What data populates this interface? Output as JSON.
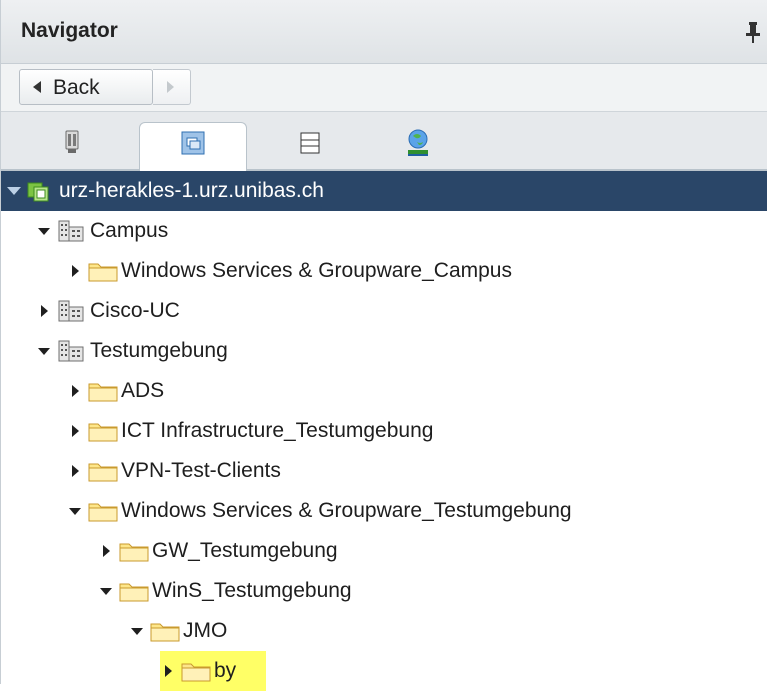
{
  "navigator": {
    "title": "Navigator"
  },
  "history": {
    "back_label": "Back"
  },
  "tabs": [
    {
      "name": "hosts-clusters",
      "icon": "hosts-icon",
      "active": false
    },
    {
      "name": "vms-templates",
      "icon": "vms-templates-icon",
      "active": true
    },
    {
      "name": "storage",
      "icon": "storage-icon",
      "active": false
    },
    {
      "name": "networking",
      "icon": "network-globe-icon",
      "active": false
    }
  ],
  "tree": [
    {
      "label": "urz-herakles-1.urz.unibas.ch",
      "icon": "vcenter-icon",
      "level": 0,
      "expander": "expanded-outline",
      "selected": true,
      "highlighted": false
    },
    {
      "label": "Campus",
      "icon": "datacenter-icon",
      "level": 1,
      "expander": "expanded",
      "selected": false,
      "highlighted": false
    },
    {
      "label": "Windows Services & Groupware_Campus",
      "icon": "folder-icon",
      "level": 2,
      "expander": "collapsed",
      "selected": false,
      "highlighted": false
    },
    {
      "label": "Cisco-UC",
      "icon": "datacenter-icon",
      "level": 1,
      "expander": "collapsed",
      "selected": false,
      "highlighted": false
    },
    {
      "label": "Testumgebung",
      "icon": "datacenter-icon",
      "level": 1,
      "expander": "expanded",
      "selected": false,
      "highlighted": false
    },
    {
      "label": "ADS",
      "icon": "folder-icon",
      "level": 2,
      "expander": "collapsed",
      "selected": false,
      "highlighted": false
    },
    {
      "label": "ICT Infrastructure_Testumgebung",
      "icon": "folder-icon",
      "level": 2,
      "expander": "collapsed",
      "selected": false,
      "highlighted": false
    },
    {
      "label": "VPN-Test-Clients",
      "icon": "folder-icon",
      "level": 2,
      "expander": "collapsed",
      "selected": false,
      "highlighted": false
    },
    {
      "label": "Windows Services & Groupware_Testumgebung",
      "icon": "folder-icon",
      "level": 2,
      "expander": "expanded",
      "selected": false,
      "highlighted": false
    },
    {
      "label": "GW_Testumgebung",
      "icon": "folder-icon",
      "level": 3,
      "expander": "collapsed",
      "selected": false,
      "highlighted": false
    },
    {
      "label": "WinS_Testumgebung",
      "icon": "folder-icon",
      "level": 3,
      "expander": "expanded",
      "selected": false,
      "highlighted": false
    },
    {
      "label": "JMO",
      "icon": "folder-icon",
      "level": 4,
      "expander": "expanded",
      "selected": false,
      "highlighted": false
    },
    {
      "label": "by",
      "icon": "folder-icon",
      "level": 5,
      "expander": "collapsed",
      "selected": false,
      "highlighted": true
    }
  ],
  "colors": {
    "selection": "#2a4668",
    "highlight": "#ffff66",
    "folder_fill": "#fde68a",
    "folder_stroke": "#c99a2e"
  }
}
